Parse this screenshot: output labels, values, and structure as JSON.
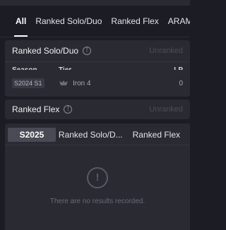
{
  "tabs": [
    "All",
    "Ranked Solo/Duo",
    "Ranked Flex",
    "ARAM"
  ],
  "solo_duo": {
    "title": "Ranked Solo/Duo",
    "status": "Unranked",
    "columns": {
      "season": "Season",
      "tier": "Tier",
      "lp": "LP"
    },
    "rows": [
      {
        "season": "S2024 S1",
        "tier": "Iron 4",
        "lp": "0"
      }
    ]
  },
  "flex": {
    "title": "Ranked Flex",
    "status": "Unranked"
  },
  "history": {
    "tabs": [
      "S2025",
      "Ranked Solo/D...",
      "Ranked Flex"
    ],
    "empty_message": "There are no results recorded."
  }
}
